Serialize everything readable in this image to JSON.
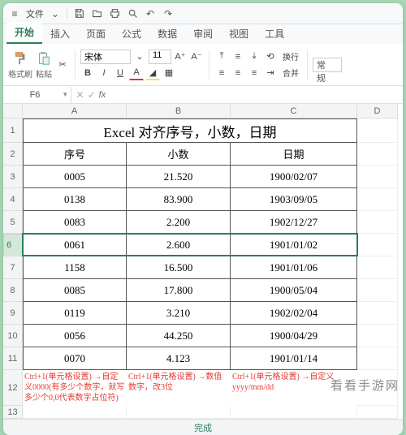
{
  "titlebar": {
    "menu": "文件"
  },
  "tabs": [
    "开始",
    "插入",
    "页面",
    "公式",
    "数据",
    "审阅",
    "视图",
    "工具"
  ],
  "active_tab": 0,
  "ribbon": {
    "format_painter": "格式刷",
    "paste": "粘贴",
    "font_name": "宋体",
    "font_size": "11",
    "wrap": "换行",
    "merge": "合并",
    "normal": "常规"
  },
  "namebox": "F6",
  "columns": [
    "A",
    "B",
    "C",
    "D"
  ],
  "title": "Excel 对齐序号，小数，日期",
  "headers": {
    "seq": "序号",
    "dec": "小数",
    "date": "日期"
  },
  "rows": [
    {
      "seq": "0005",
      "dec": "21.520",
      "date": "1900/02/07"
    },
    {
      "seq": "0138",
      "dec": "83.900",
      "date": "1903/09/05"
    },
    {
      "seq": "0083",
      "dec": "2.200",
      "date": "1902/12/27"
    },
    {
      "seq": "0061",
      "dec": "2.600",
      "date": "1901/01/02"
    },
    {
      "seq": "1158",
      "dec": "16.500",
      "date": "1901/01/06"
    },
    {
      "seq": "0085",
      "dec": "17.800",
      "date": "1900/05/04"
    },
    {
      "seq": "0119",
      "dec": "3.210",
      "date": "1902/02/04"
    },
    {
      "seq": "0056",
      "dec": "44.250",
      "date": "1900/04/29"
    },
    {
      "seq": "0070",
      "dec": "4.123",
      "date": "1901/01/14"
    }
  ],
  "tips": {
    "a": "Ctrl+1(单元格设置) →自定义0000(有多少个数字，就写多少个0,0代表数字占位符)",
    "b": "Ctrl+1(单元格设置) →数值 数字，改3位",
    "c": "Ctrl+1(单元格设置) →自定义yyyy/mm/dd"
  },
  "footer": "完成",
  "watermark": "看看手游网"
}
